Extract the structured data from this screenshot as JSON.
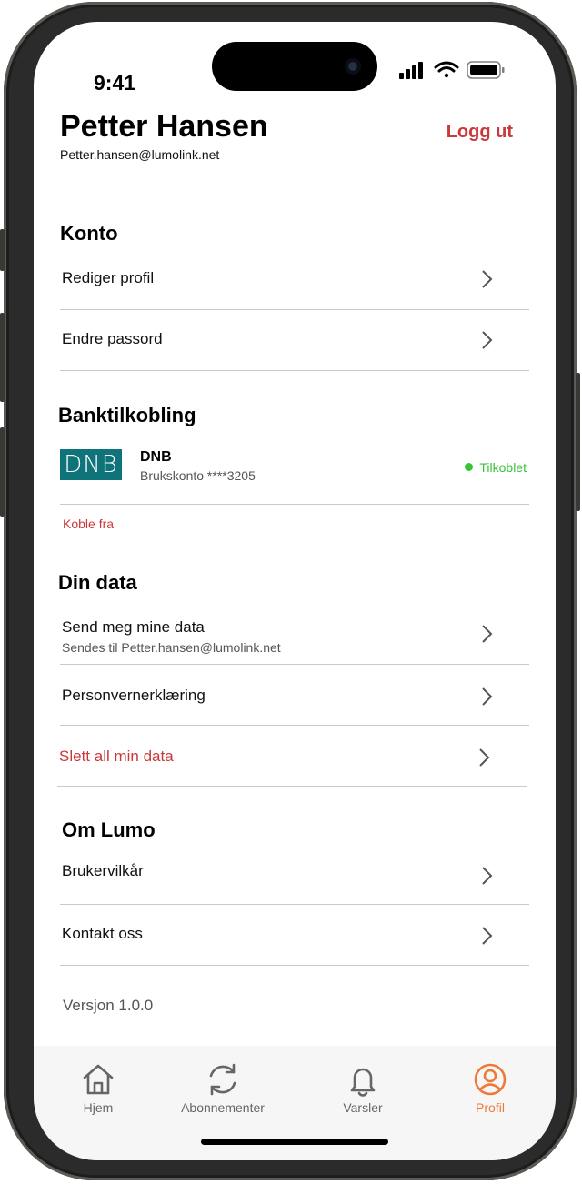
{
  "status_bar": {
    "time": "9:41"
  },
  "header": {
    "name": "Petter Hansen",
    "email": "Petter.hansen@lumolink.net",
    "logout_label": "Logg ut"
  },
  "sections": {
    "account": {
      "title": "Konto",
      "items": [
        {
          "label": "Rediger profil"
        },
        {
          "label": "Endre passord"
        }
      ]
    },
    "bank": {
      "title": "Banktilkobling",
      "bank_logo_text": "DNB",
      "bank_name": "DNB",
      "account": "Brukskonto ****3205",
      "status": "Tilkoblet",
      "disconnect_label": "Koble fra"
    },
    "data": {
      "title": "Din data",
      "items": [
        {
          "label": "Send meg mine data",
          "sub": "Sendes til Petter.hansen@lumolink.net"
        },
        {
          "label": "Personvernerklæring"
        },
        {
          "label": "Slett all min data"
        }
      ]
    },
    "about": {
      "title": "Om Lumo",
      "items": [
        {
          "label": "Brukervilkår"
        },
        {
          "label": "Kontakt oss"
        }
      ]
    }
  },
  "version": "Versjon 1.0.0",
  "tabbar": {
    "items": [
      {
        "label": "Hjem",
        "icon": "home-icon"
      },
      {
        "label": "Abonnementer",
        "icon": "refresh-icon"
      },
      {
        "label": "Varsler",
        "icon": "bell-icon"
      },
      {
        "label": "Profil",
        "icon": "profile-icon",
        "active": true
      }
    ]
  },
  "colors": {
    "danger": "#c9383a",
    "accent": "#ee7a3a",
    "connected": "#34c531",
    "dnb_brand": "#0e7479"
  }
}
